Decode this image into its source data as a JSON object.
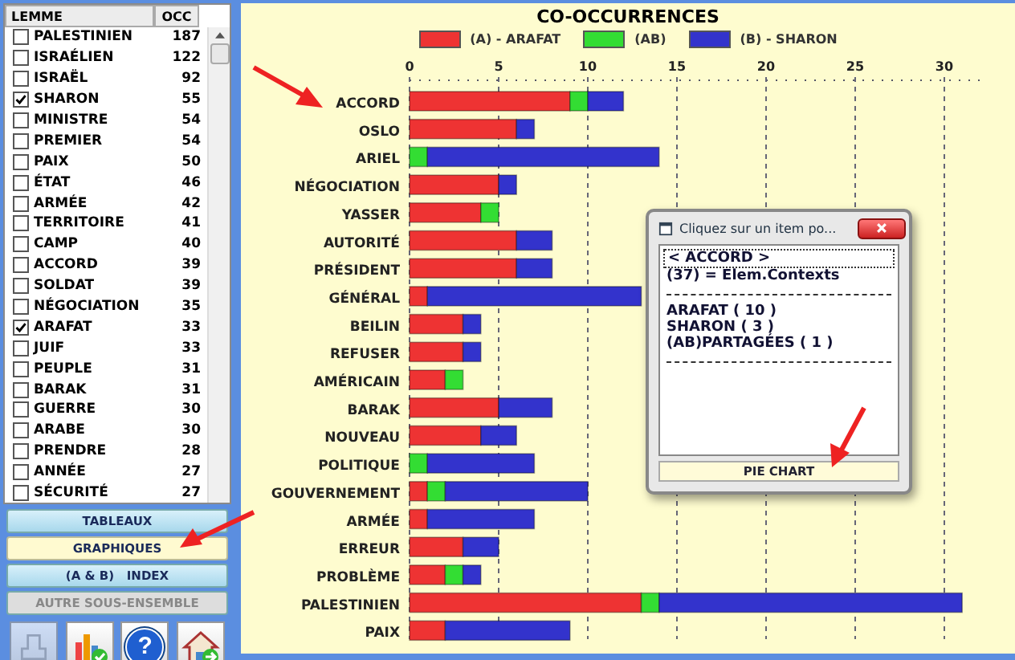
{
  "list": {
    "columns": [
      "LEMME",
      "OCC"
    ],
    "rows": [
      {
        "label": "PALESTINIEN",
        "occ": "187",
        "checked": false
      },
      {
        "label": "ISRAÉLIEN",
        "occ": "122",
        "checked": false
      },
      {
        "label": "ISRAËL",
        "occ": "92",
        "checked": false
      },
      {
        "label": "SHARON",
        "occ": "55",
        "checked": true
      },
      {
        "label": "MINISTRE",
        "occ": "54",
        "checked": false
      },
      {
        "label": "PREMIER",
        "occ": "54",
        "checked": false
      },
      {
        "label": "PAIX",
        "occ": "50",
        "checked": false
      },
      {
        "label": "ÉTAT",
        "occ": "46",
        "checked": false
      },
      {
        "label": "ARMÉE",
        "occ": "42",
        "checked": false
      },
      {
        "label": "TERRITOIRE",
        "occ": "41",
        "checked": false
      },
      {
        "label": "CAMP",
        "occ": "40",
        "checked": false
      },
      {
        "label": "ACCORD",
        "occ": "39",
        "checked": false
      },
      {
        "label": "SOLDAT",
        "occ": "39",
        "checked": false
      },
      {
        "label": "NÉGOCIATION",
        "occ": "35",
        "checked": false
      },
      {
        "label": "ARAFAT",
        "occ": "33",
        "checked": true
      },
      {
        "label": "JUIF",
        "occ": "33",
        "checked": false
      },
      {
        "label": "PEUPLE",
        "occ": "31",
        "checked": false
      },
      {
        "label": "BARAK",
        "occ": "31",
        "checked": false
      },
      {
        "label": "GUERRE",
        "occ": "30",
        "checked": false
      },
      {
        "label": "ARABE",
        "occ": "30",
        "checked": false
      },
      {
        "label": "PRENDRE",
        "occ": "28",
        "checked": false
      },
      {
        "label": "ANNÉE",
        "occ": "27",
        "checked": false
      },
      {
        "label": "SÉCURITÉ",
        "occ": "27",
        "checked": false
      }
    ]
  },
  "buttons": [
    {
      "label": "TABLEAUX",
      "selected": false,
      "disabled": false
    },
    {
      "label": "GRAPHIQUES",
      "selected": true,
      "disabled": false
    },
    {
      "label": "(A & B)   INDEX",
      "selected": false,
      "disabled": false
    },
    {
      "label": "AUTRE SOUS-ENSEMBLE",
      "selected": false,
      "disabled": true
    }
  ],
  "toolbar": [
    {
      "kind": "print",
      "disabled": true
    },
    {
      "kind": "chart",
      "disabled": false
    },
    {
      "kind": "help",
      "label": "?",
      "disabled": false
    },
    {
      "kind": "home",
      "disabled": false
    }
  ],
  "chart": {
    "chart_data": {
      "type": "bar",
      "orientation": "horizontal",
      "stacked": true,
      "title": "CO-OCCURRENCES",
      "categories": [
        "ACCORD",
        "OSLO",
        "ARIEL",
        "NÉGOCIATION",
        "YASSER",
        "AUTORITÉ",
        "PRÉSIDENT",
        "GÉNÉRAL",
        "BEILIN",
        "REFUSER",
        "AMÉRICAIN",
        "BARAK",
        "NOUVEAU",
        "POLITIQUE",
        "GOUVERNEMENT",
        "ARMÉE",
        "ERREUR",
        "PROBLÈME",
        "PALESTINIEN",
        "PAIX"
      ],
      "grid": true,
      "xlim": [
        0,
        32
      ],
      "xticks": [
        0,
        5,
        10,
        15,
        20,
        25,
        30
      ],
      "series": [
        {
          "name": "(A) - ARAFAT",
          "color": "#ee3333",
          "values": [
            9,
            6,
            0,
            5,
            4,
            6,
            6,
            1,
            3,
            3,
            2,
            5,
            4,
            0,
            1,
            1,
            3,
            2,
            13,
            2
          ]
        },
        {
          "name": "(AB)",
          "color": "#33dd33",
          "values": [
            1,
            0,
            1,
            0,
            1,
            0,
            0,
            0,
            0,
            0,
            1,
            0,
            0,
            1,
            1,
            0,
            0,
            1,
            1,
            0
          ]
        },
        {
          "name": "(B) - SHARON",
          "color": "#3333cc",
          "values": [
            2,
            1,
            13,
            1,
            0,
            2,
            2,
            12,
            1,
            1,
            0,
            3,
            2,
            6,
            8,
            6,
            2,
            1,
            17,
            7
          ]
        }
      ]
    }
  },
  "popup": {
    "title": "Cliquez sur un item po...",
    "header": "< ACCORD >",
    "lines": [
      "(37) = Elem.Contexts"
    ],
    "counts": [
      "ARAFAT ( 10 )",
      "SHARON ( 3 )",
      "(AB)PARTAGÉES ( 1 )"
    ],
    "button": "PIE CHART"
  }
}
